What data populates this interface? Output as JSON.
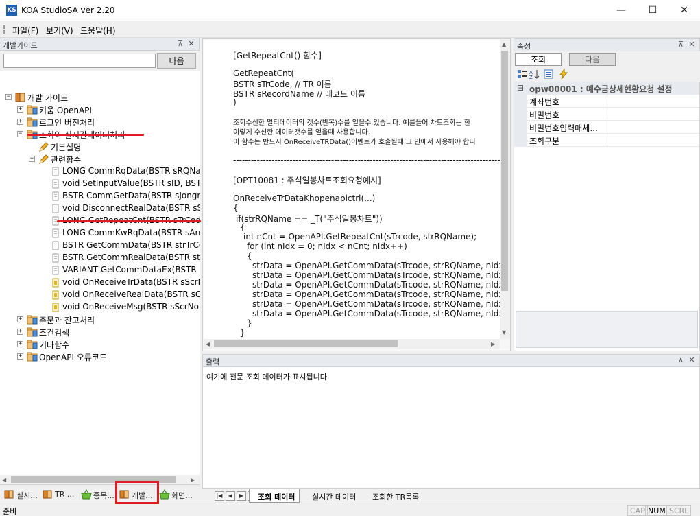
{
  "app": {
    "title": "KOA StudioSA ver 2.20",
    "icon_text": "KS"
  },
  "window_controls": {
    "minimize": "—",
    "maximize": "☐",
    "close": "✕"
  },
  "menu": {
    "items": [
      "파일(F)",
      "보기(V)",
      "도움말(H)"
    ]
  },
  "left_panel": {
    "title": "개발가이드",
    "search_value": "",
    "next_button": "다음",
    "tree": [
      {
        "label": "개발 가이드",
        "level": 0,
        "icon": "book-icon",
        "expander": "⊟"
      },
      {
        "label": "키움 OpenAPI",
        "level": 1,
        "icon": "folder-icon",
        "expander": "⊞"
      },
      {
        "label": "로그인 버전처리",
        "level": 1,
        "icon": "folder-icon",
        "expander": "⊞"
      },
      {
        "label": "조회와 실시간데이터처리",
        "level": 1,
        "icon": "folder-icon",
        "expander": "⊟"
      },
      {
        "label": "기본설명",
        "level": 2,
        "icon": "pencil-icon",
        "expander": ""
      },
      {
        "label": "관련함수",
        "level": 2,
        "icon": "pencil-icon",
        "expander": "⊟"
      },
      {
        "label": "LONG CommRqData(BSTR sRQName",
        "level": 3,
        "icon": "page-icon",
        "expander": ""
      },
      {
        "label": "void SetInputValue(BSTR sID, BSTR",
        "level": 3,
        "icon": "page-icon",
        "expander": ""
      },
      {
        "label": "BSTR CommGetData(BSTR sJongmo",
        "level": 3,
        "icon": "page-icon",
        "expander": ""
      },
      {
        "label": "void DisconnectRealData(BSTR sSc",
        "level": 3,
        "icon": "page-icon",
        "expander": ""
      },
      {
        "label": "LONG GetRepeatCnt(BSTR sTrCode",
        "level": 3,
        "icon": "page-icon",
        "expander": ""
      },
      {
        "label": "LONG CommKwRqData(BSTR sArr",
        "level": 3,
        "icon": "page-icon",
        "expander": ""
      },
      {
        "label": "BSTR GetCommData(BSTR strTrCo",
        "level": 3,
        "icon": "page-icon",
        "expander": ""
      },
      {
        "label": "BSTR GetCommRealData(BSTR strC",
        "level": 3,
        "icon": "page-icon",
        "expander": ""
      },
      {
        "label": "VARIANT GetCommDataEx(BSTR s",
        "level": 3,
        "icon": "page-icon",
        "expander": ""
      },
      {
        "label": "void OnReceiveTrData(BSTR sScrN",
        "level": 3,
        "icon": "event-icon",
        "expander": ""
      },
      {
        "label": "void OnReceiveRealData(BSTR sCo",
        "level": 3,
        "icon": "event-icon",
        "expander": ""
      },
      {
        "label": "void OnReceiveMsg(BSTR sScrNo,",
        "level": 3,
        "icon": "event-icon",
        "expander": ""
      },
      {
        "label": "주문과 잔고처리",
        "level": 1,
        "icon": "folder-icon",
        "expander": "⊞"
      },
      {
        "label": "조건검색",
        "level": 1,
        "icon": "folder-icon",
        "expander": "⊞"
      },
      {
        "label": "기타함수",
        "level": 1,
        "icon": "folder-icon",
        "expander": "⊞"
      },
      {
        "label": "OpenAPI 오류코드",
        "level": 1,
        "icon": "folder-icon",
        "expander": "⊞"
      }
    ],
    "bottom_tabs": [
      "실시...",
      "TR ...",
      "종목...",
      "개발...",
      "화면..."
    ]
  },
  "doc": {
    "lines": [
      {
        "text": "[GetRepeatCnt() 함수]",
        "small": false
      },
      {
        "text": "GetRepeatCnt(",
        "small": false
      },
      {
        "text": "BSTR sTrCode, // TR 이름",
        "small": false
      },
      {
        "text": "BSTR sRecordName // 레코드 이름",
        "small": false
      },
      {
        "text": ")",
        "small": false
      },
      {
        "text": "조회수신한 멀티데이터의 갯수(반복)수를 얻을수 있습니다. 예를들어 차트조회는 한",
        "small": true
      },
      {
        "text": "이렇게 수신한 데이터갯수를 얻을때 사용합니다.",
        "small": true
      },
      {
        "text": "이 함수는 반드시 OnReceiveTRData()이벤트가 호출될때 그 안에서 사용해야 합니",
        "small": true
      },
      {
        "text": "------------------------------------------------------------------------------------------------",
        "small": false
      },
      {
        "text": "[OPT10081 : 주식일봉차트조회요청예시]",
        "small": false
      },
      {
        "text": "OnReceiveTrDataKhopenapictrl(...)",
        "small": false
      },
      {
        "text": "{",
        "small": false
      },
      {
        "text": "if(strRQName == _T(\"주식일봉차트\"))",
        "small": false
      },
      {
        "text": "{",
        "small": false
      },
      {
        "text": "int nCnt = OpenAPI.GetRepeatCnt(sTrcode, strRQName);",
        "small": false
      },
      {
        "text": "for (int nIdx = 0; nIdx < nCnt; nIdx++)",
        "small": false
      },
      {
        "text": "{",
        "small": false
      },
      {
        "text": "strData = OpenAPI.GetCommData(sTrcode, strRQName, nIdx, _T",
        "small": false
      },
      {
        "text": "strData = OpenAPI.GetCommData(sTrcode, strRQName, nIdx, _T",
        "small": false
      },
      {
        "text": "strData = OpenAPI.GetCommData(sTrcode, strRQName, nIdx, _T",
        "small": false
      },
      {
        "text": "strData = OpenAPI.GetCommData(sTrcode, strRQName, nIdx, _T",
        "small": false
      },
      {
        "text": "strData = OpenAPI.GetCommData(sTrcode, strRQName, nIdx, _T",
        "small": false
      },
      {
        "text": "strData = OpenAPI.GetCommData(sTrcode, strRQName, nIdx, _T",
        "small": false
      },
      {
        "text": "}",
        "small": false
      },
      {
        "text": "}",
        "small": false
      }
    ]
  },
  "properties": {
    "title": "속성",
    "tabs": [
      "조회",
      "다음"
    ],
    "category": "opw00001 : 예수금상세현황요청 설정",
    "rows": [
      {
        "name": "계좌번호",
        "value": ""
      },
      {
        "name": "비밀번호",
        "value": ""
      },
      {
        "name": "비밀번호입력매체...",
        "value": ""
      },
      {
        "name": "조회구분",
        "value": ""
      }
    ]
  },
  "output": {
    "title": "출력",
    "text": "여기에 전문 조회 데이터가 표시됩니다.",
    "tabs": [
      "조회 데이터",
      "실시간 데이터",
      "조회한 TR목록"
    ]
  },
  "statusbar": {
    "text": "준비",
    "indicators": [
      {
        "label": "CAP",
        "on": false
      },
      {
        "label": "NUM",
        "on": true
      },
      {
        "label": "SCRL",
        "on": false
      }
    ]
  },
  "colors": {
    "annotation_red": "#e01b24",
    "app_icon_blue": "#1e5fb3"
  }
}
